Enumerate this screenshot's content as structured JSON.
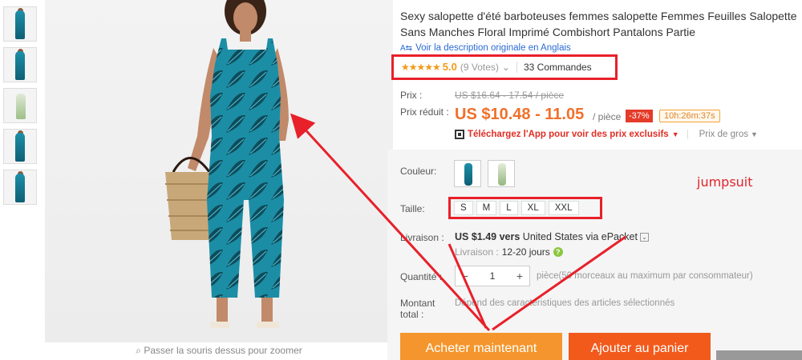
{
  "thumbnails": [
    "teal",
    "teal",
    "light",
    "teal",
    "teal"
  ],
  "zoom_hint": "Passer la souris dessus pour zoomer",
  "product": {
    "title": "Sexy salopette d'été barboteuses femmes salopette Femmes Feuilles Salopette Sans Manches Floral Imprimé Combishort Pantalons Partie",
    "translate_link": "Voir la description originale en Anglais",
    "translate_icon": "translate-icon"
  },
  "rating": {
    "stars": "★★★★★",
    "score": "5.0",
    "votes": "(9 Votes)",
    "orders": "33 Commandes"
  },
  "price": {
    "label_price": "Prix :",
    "original": "US $16.64 - 17.54 / pièce",
    "label_reduced": "Prix réduit :",
    "current": "US $10.48 - 11.05",
    "per": "/ pièce",
    "discount": "-37%",
    "timer": "10h:26m:37s",
    "app_promo": "Téléchargez l'App pour voir des prix exclusifs",
    "wholesale": "Prix de gros"
  },
  "options": {
    "color_label": "Couleur:",
    "swatches": [
      "teal",
      "light"
    ],
    "size_label": "Taille:",
    "sizes": [
      "S",
      "M",
      "L",
      "XL",
      "XXL"
    ]
  },
  "shipping": {
    "label": "Livraison :",
    "price": "US $1.49 vers",
    "destination": "United States via ePacket",
    "delivery_label": "Livraison :",
    "delivery_days": "12-20 jours"
  },
  "quantity": {
    "label": "Quantité :",
    "minus": "−",
    "value": "1",
    "plus": "+",
    "note": "pièce(50 morceaux au maximum par consommateur)"
  },
  "total": {
    "label_line1": "Montant",
    "label_line2": "total :",
    "note": "Dépend des caractéristiques des articles sélectionnés"
  },
  "buttons": {
    "buy": "Acheter maintenant",
    "cart": "Ajouter au panier"
  },
  "annotation": "jumpsuit",
  "colors": {
    "accent_orange": "#f0702a",
    "buy_button": "#f4962d",
    "cart_button": "#f25a1c",
    "highlight_red": "#e8202a",
    "star": "#f29b18"
  }
}
